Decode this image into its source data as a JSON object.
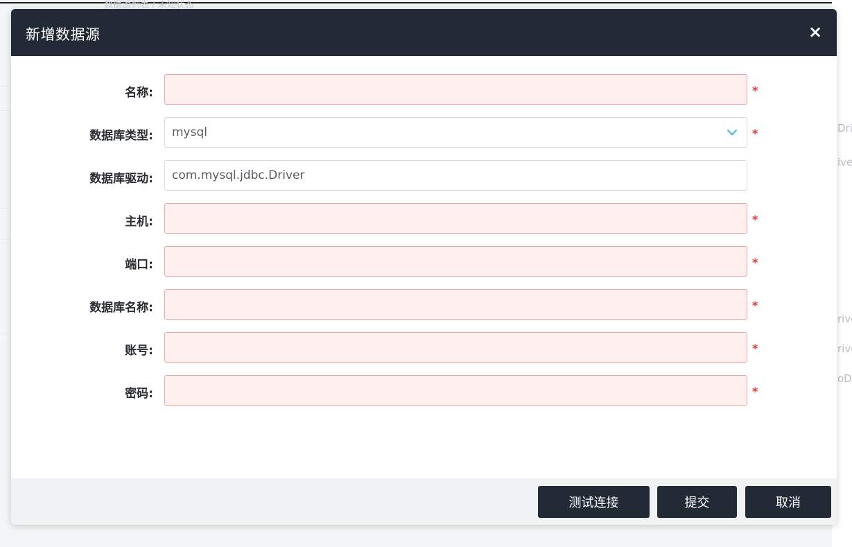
{
  "backdrop": {
    "title_fragment": "数据源列表 / 未知状态",
    "peek_texts": [
      "Dri",
      "ive",
      "rive",
      "rive",
      "oD"
    ]
  },
  "dialog": {
    "title": "新增数据源",
    "close_glyph": "×"
  },
  "form": {
    "required_mark": "*",
    "fields": [
      {
        "label": "名称:",
        "value": "",
        "required": true
      },
      {
        "label": "数据库类型:",
        "value": "mysql",
        "required": true,
        "type": "select"
      },
      {
        "label": "数据库驱动:",
        "value": "com.mysql.jdbc.Driver",
        "required": false
      },
      {
        "label": "主机:",
        "value": "",
        "required": true
      },
      {
        "label": "端口:",
        "value": "",
        "required": true
      },
      {
        "label": "数据库名称:",
        "value": "",
        "required": true
      },
      {
        "label": "账号:",
        "value": "",
        "required": true
      },
      {
        "label": "密码:",
        "value": "",
        "required": true
      }
    ]
  },
  "footer": {
    "test_connection": "测试连接",
    "submit": "提交",
    "cancel": "取消"
  },
  "colors": {
    "header_bg": "#222a35",
    "button_bg": "#222a35",
    "required_bg": "#ffeeee",
    "required_border": "#f2a3a3",
    "required_star": "#e33b3b",
    "chevron": "#5bc0de"
  },
  "icons": {
    "close": "close-icon",
    "select": "chevron-down-icon"
  }
}
